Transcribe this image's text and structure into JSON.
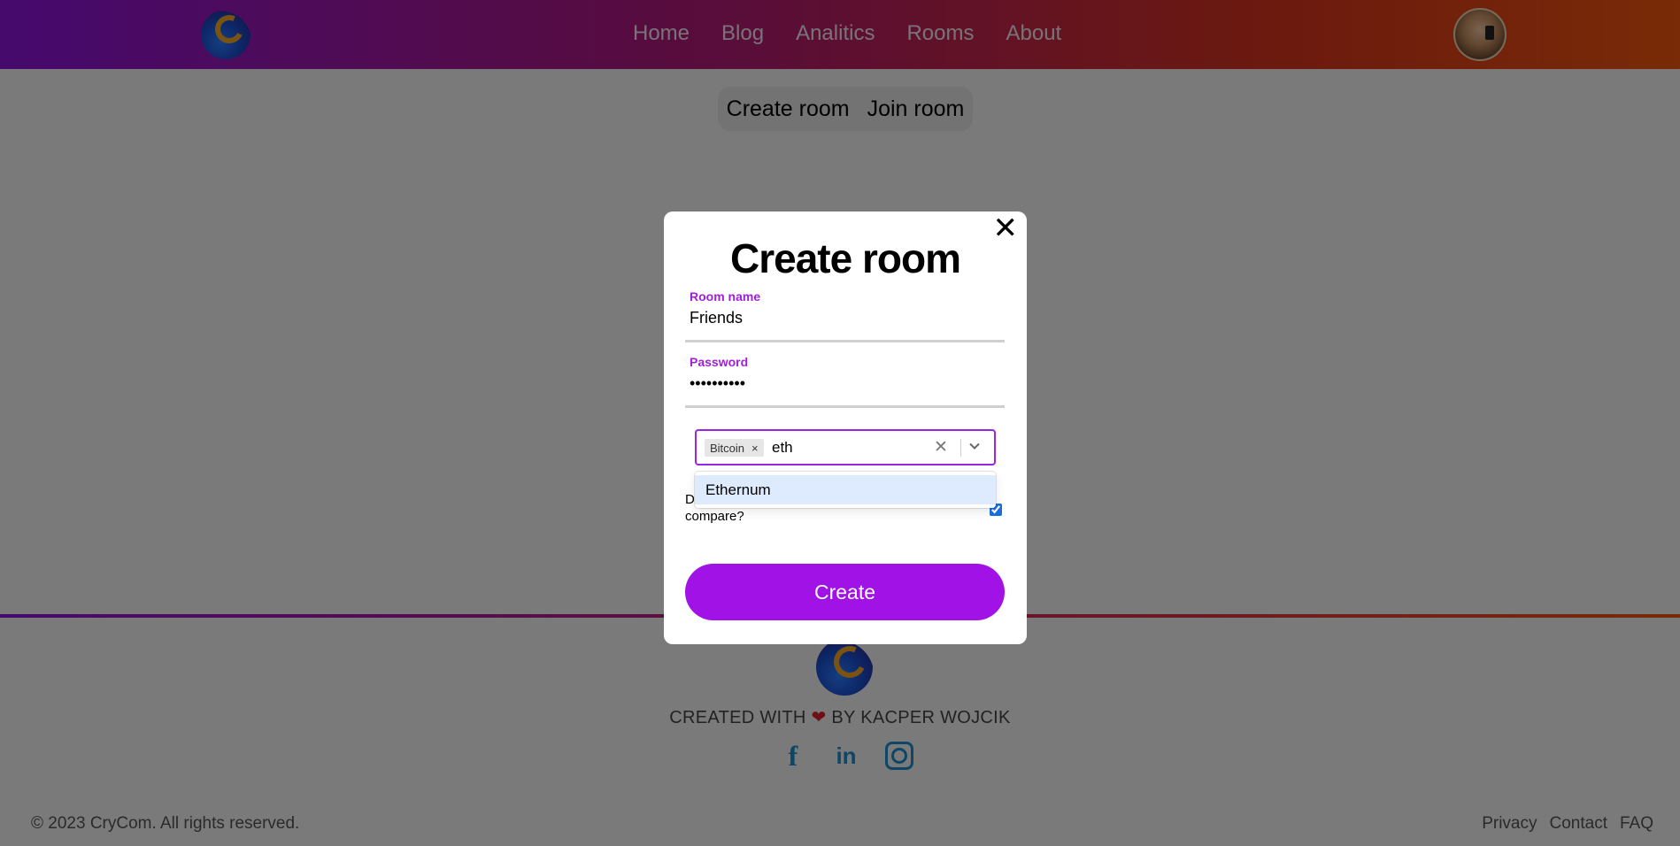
{
  "header": {
    "nav": [
      "Home",
      "Blog",
      "Analitics",
      "Rooms",
      "About"
    ]
  },
  "room_tabs": {
    "create": "Create room",
    "join": "Join room"
  },
  "footer": {
    "credit_prefix": "CREATED WITH",
    "heart": "❤",
    "credit_suffix": "BY KACPER WOJCIK",
    "copyright": "© 2023 CryCom. All rights reserved.",
    "links": [
      "Privacy",
      "Contact",
      "FAQ"
    ]
  },
  "modal": {
    "close": "✕",
    "title": "Create room",
    "room_name": {
      "label": "Room name",
      "value": "Friends"
    },
    "password": {
      "label": "Password",
      "value": "••••••••••"
    },
    "coins": {
      "chips": [
        "Bitcoin"
      ],
      "chip_remove": "×",
      "search_value": "eth",
      "clear": "✕",
      "options": [
        "Ethernum"
      ]
    },
    "consent_text": "D compare?",
    "consent_checked": true,
    "submit": "Create"
  },
  "colors": {
    "accent": "#a012e6",
    "label": "#a020d8"
  }
}
